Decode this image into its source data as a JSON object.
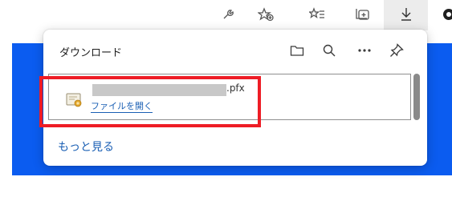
{
  "toolbar": {
    "icons": [
      "extensions-icon",
      "favorites-add-icon",
      "favorites-icon",
      "collections-icon",
      "downloads-icon",
      "profile-icon"
    ]
  },
  "downloads": {
    "title": "ダウンロード",
    "item": {
      "file_ext": ".pfx",
      "open_label": "ファイルを開く"
    },
    "more_label": "もっと見る"
  },
  "colors": {
    "background_blue": "#0b5cf0",
    "highlight_red": "#ee1c25",
    "link_blue": "#1a5fb4"
  }
}
